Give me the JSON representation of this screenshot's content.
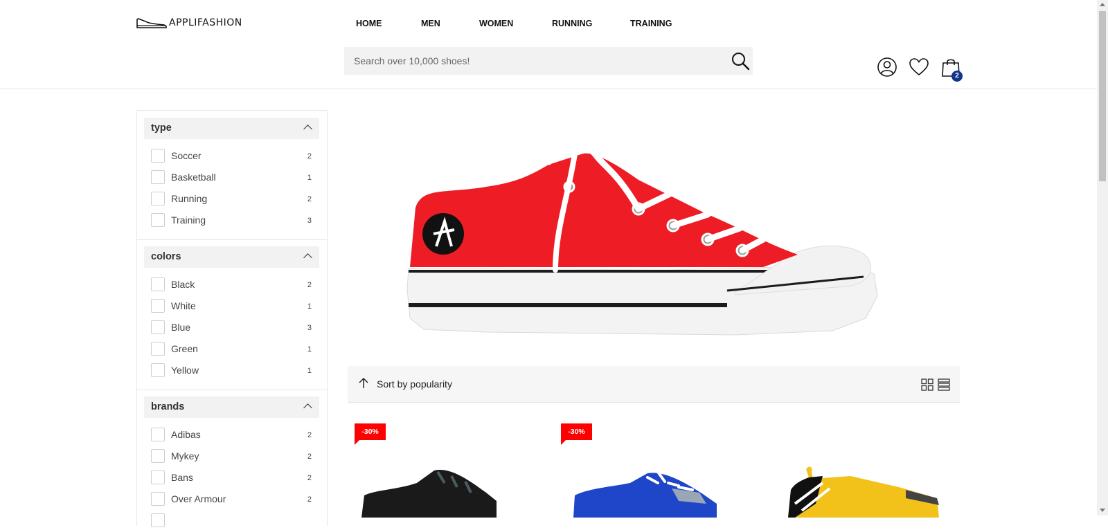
{
  "header": {
    "logo_text": "APPLIFASHION",
    "nav": [
      {
        "label": "HOME"
      },
      {
        "label": "MEN"
      },
      {
        "label": "WOMEN"
      },
      {
        "label": "RUNNING"
      },
      {
        "label": "TRAINING"
      }
    ],
    "search": {
      "placeholder": "Search over 10,000 shoes!"
    },
    "cart_count": "2"
  },
  "filters": [
    {
      "title": "type",
      "options": [
        {
          "label": "Soccer",
          "count": "2"
        },
        {
          "label": "Basketball",
          "count": "1"
        },
        {
          "label": "Running",
          "count": "2"
        },
        {
          "label": "Training",
          "count": "3"
        }
      ]
    },
    {
      "title": "colors",
      "options": [
        {
          "label": "Black",
          "count": "2"
        },
        {
          "label": "White",
          "count": "1"
        },
        {
          "label": "Blue",
          "count": "3"
        },
        {
          "label": "Green",
          "count": "1"
        },
        {
          "label": "Yellow",
          "count": "1"
        }
      ]
    },
    {
      "title": "brands",
      "options": [
        {
          "label": "Adibas",
          "count": "2"
        },
        {
          "label": "Mykey",
          "count": "2"
        },
        {
          "label": "Bans",
          "count": "2"
        },
        {
          "label": "Over Armour",
          "count": "2"
        }
      ]
    }
  ],
  "toolbar": {
    "sort_label": "Sort by popularity"
  },
  "products": [
    {
      "discount": "-30%",
      "color": "#1a1a1a"
    },
    {
      "discount": "-30%",
      "color": "#1f45c8"
    },
    {
      "discount": "",
      "color": "#f2c21a"
    }
  ],
  "colors": {
    "accent": "#ff0000",
    "badge": "#12358a",
    "panel": "#f2f2f2"
  },
  "icons": [
    "shoe-logo-icon",
    "search-icon",
    "user-icon",
    "heart-icon",
    "bag-icon",
    "chevron-up-icon",
    "sort-arrow-icon",
    "grid-view-icon",
    "list-view-icon"
  ]
}
